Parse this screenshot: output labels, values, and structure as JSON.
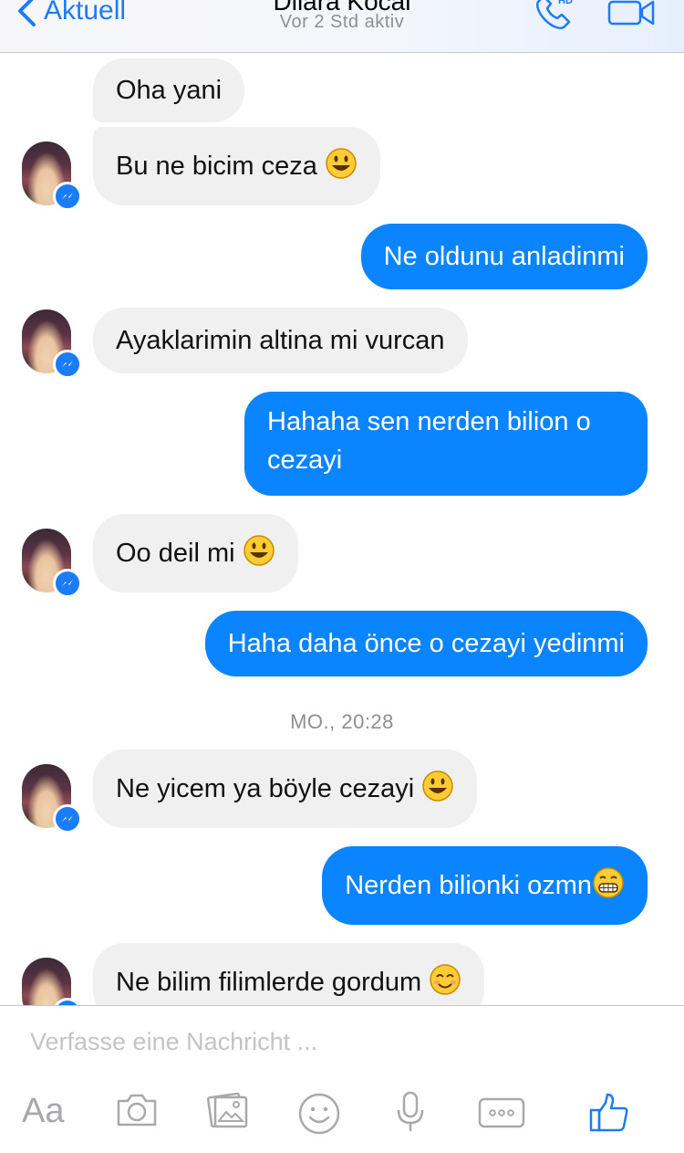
{
  "header": {
    "back_label": "Aktuell",
    "contact_name": "Dilara Kocal",
    "status": "Vor 2 Std aktiv",
    "phone_badge": "HD"
  },
  "messages": [
    {
      "dir": "in",
      "text": "Oha yani"
    },
    {
      "dir": "in",
      "text": "Bu ne bicim ceza",
      "emoji": "smiley"
    },
    {
      "dir": "out",
      "text": "Ne oldunu anladinmi"
    },
    {
      "dir": "in",
      "text": "Ayaklarimin altina mi vurcan"
    },
    {
      "dir": "out",
      "line1": "Hahaha sen nerden bilion o",
      "line2": "cezayi"
    },
    {
      "dir": "in",
      "text": "Oo deil mi",
      "emoji": "smiley"
    },
    {
      "dir": "out",
      "text": "Haha daha önce o cezayi yedinmi"
    },
    {
      "dir": "in",
      "text": "Ne yicem ya böyle cezayi",
      "emoji": "smiley"
    },
    {
      "dir": "out",
      "text": "Nerden bilionki ozmn",
      "emoji": "grin"
    },
    {
      "dir": "in",
      "text": "Ne bilim filimlerde gordum",
      "emoji": "blush"
    }
  ],
  "timestamp": "MO., 20:28",
  "composer": {
    "placeholder": "Verfasse eine Nachricht ...",
    "text_label": "Aa",
    "tools": [
      "camera-icon",
      "gallery-icon",
      "emoji-icon",
      "microphone-icon",
      "more-icon",
      "like-icon"
    ]
  },
  "colors": {
    "accent": "#1a7cf7",
    "outgoing_bubble": "#0b84ff",
    "incoming_bubble": "#f1f0f0"
  }
}
